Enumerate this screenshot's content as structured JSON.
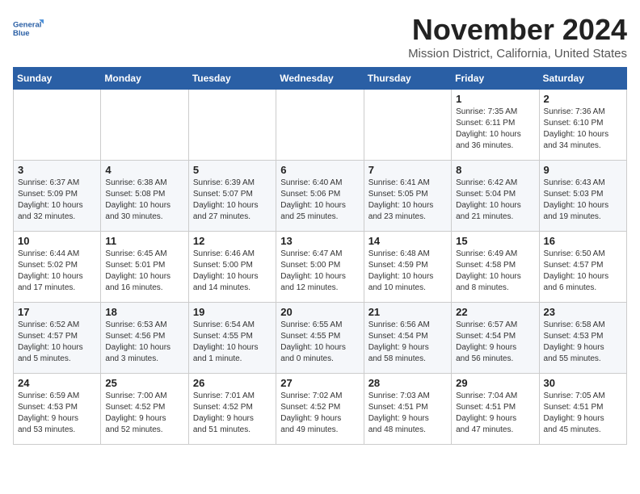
{
  "logo": {
    "line1": "General",
    "line2": "Blue"
  },
  "title": "November 2024",
  "location": "Mission District, California, United States",
  "weekdays": [
    "Sunday",
    "Monday",
    "Tuesday",
    "Wednesday",
    "Thursday",
    "Friday",
    "Saturday"
  ],
  "weeks": [
    [
      {
        "day": "",
        "info": ""
      },
      {
        "day": "",
        "info": ""
      },
      {
        "day": "",
        "info": ""
      },
      {
        "day": "",
        "info": ""
      },
      {
        "day": "",
        "info": ""
      },
      {
        "day": "1",
        "info": "Sunrise: 7:35 AM\nSunset: 6:11 PM\nDaylight: 10 hours\nand 36 minutes."
      },
      {
        "day": "2",
        "info": "Sunrise: 7:36 AM\nSunset: 6:10 PM\nDaylight: 10 hours\nand 34 minutes."
      }
    ],
    [
      {
        "day": "3",
        "info": "Sunrise: 6:37 AM\nSunset: 5:09 PM\nDaylight: 10 hours\nand 32 minutes."
      },
      {
        "day": "4",
        "info": "Sunrise: 6:38 AM\nSunset: 5:08 PM\nDaylight: 10 hours\nand 30 minutes."
      },
      {
        "day": "5",
        "info": "Sunrise: 6:39 AM\nSunset: 5:07 PM\nDaylight: 10 hours\nand 27 minutes."
      },
      {
        "day": "6",
        "info": "Sunrise: 6:40 AM\nSunset: 5:06 PM\nDaylight: 10 hours\nand 25 minutes."
      },
      {
        "day": "7",
        "info": "Sunrise: 6:41 AM\nSunset: 5:05 PM\nDaylight: 10 hours\nand 23 minutes."
      },
      {
        "day": "8",
        "info": "Sunrise: 6:42 AM\nSunset: 5:04 PM\nDaylight: 10 hours\nand 21 minutes."
      },
      {
        "day": "9",
        "info": "Sunrise: 6:43 AM\nSunset: 5:03 PM\nDaylight: 10 hours\nand 19 minutes."
      }
    ],
    [
      {
        "day": "10",
        "info": "Sunrise: 6:44 AM\nSunset: 5:02 PM\nDaylight: 10 hours\nand 17 minutes."
      },
      {
        "day": "11",
        "info": "Sunrise: 6:45 AM\nSunset: 5:01 PM\nDaylight: 10 hours\nand 16 minutes."
      },
      {
        "day": "12",
        "info": "Sunrise: 6:46 AM\nSunset: 5:00 PM\nDaylight: 10 hours\nand 14 minutes."
      },
      {
        "day": "13",
        "info": "Sunrise: 6:47 AM\nSunset: 5:00 PM\nDaylight: 10 hours\nand 12 minutes."
      },
      {
        "day": "14",
        "info": "Sunrise: 6:48 AM\nSunset: 4:59 PM\nDaylight: 10 hours\nand 10 minutes."
      },
      {
        "day": "15",
        "info": "Sunrise: 6:49 AM\nSunset: 4:58 PM\nDaylight: 10 hours\nand 8 minutes."
      },
      {
        "day": "16",
        "info": "Sunrise: 6:50 AM\nSunset: 4:57 PM\nDaylight: 10 hours\nand 6 minutes."
      }
    ],
    [
      {
        "day": "17",
        "info": "Sunrise: 6:52 AM\nSunset: 4:57 PM\nDaylight: 10 hours\nand 5 minutes."
      },
      {
        "day": "18",
        "info": "Sunrise: 6:53 AM\nSunset: 4:56 PM\nDaylight: 10 hours\nand 3 minutes."
      },
      {
        "day": "19",
        "info": "Sunrise: 6:54 AM\nSunset: 4:55 PM\nDaylight: 10 hours\nand 1 minute."
      },
      {
        "day": "20",
        "info": "Sunrise: 6:55 AM\nSunset: 4:55 PM\nDaylight: 10 hours\nand 0 minutes."
      },
      {
        "day": "21",
        "info": "Sunrise: 6:56 AM\nSunset: 4:54 PM\nDaylight: 9 hours\nand 58 minutes."
      },
      {
        "day": "22",
        "info": "Sunrise: 6:57 AM\nSunset: 4:54 PM\nDaylight: 9 hours\nand 56 minutes."
      },
      {
        "day": "23",
        "info": "Sunrise: 6:58 AM\nSunset: 4:53 PM\nDaylight: 9 hours\nand 55 minutes."
      }
    ],
    [
      {
        "day": "24",
        "info": "Sunrise: 6:59 AM\nSunset: 4:53 PM\nDaylight: 9 hours\nand 53 minutes."
      },
      {
        "day": "25",
        "info": "Sunrise: 7:00 AM\nSunset: 4:52 PM\nDaylight: 9 hours\nand 52 minutes."
      },
      {
        "day": "26",
        "info": "Sunrise: 7:01 AM\nSunset: 4:52 PM\nDaylight: 9 hours\nand 51 minutes."
      },
      {
        "day": "27",
        "info": "Sunrise: 7:02 AM\nSunset: 4:52 PM\nDaylight: 9 hours\nand 49 minutes."
      },
      {
        "day": "28",
        "info": "Sunrise: 7:03 AM\nSunset: 4:51 PM\nDaylight: 9 hours\nand 48 minutes."
      },
      {
        "day": "29",
        "info": "Sunrise: 7:04 AM\nSunset: 4:51 PM\nDaylight: 9 hours\nand 47 minutes."
      },
      {
        "day": "30",
        "info": "Sunrise: 7:05 AM\nSunset: 4:51 PM\nDaylight: 9 hours\nand 45 minutes."
      }
    ]
  ]
}
